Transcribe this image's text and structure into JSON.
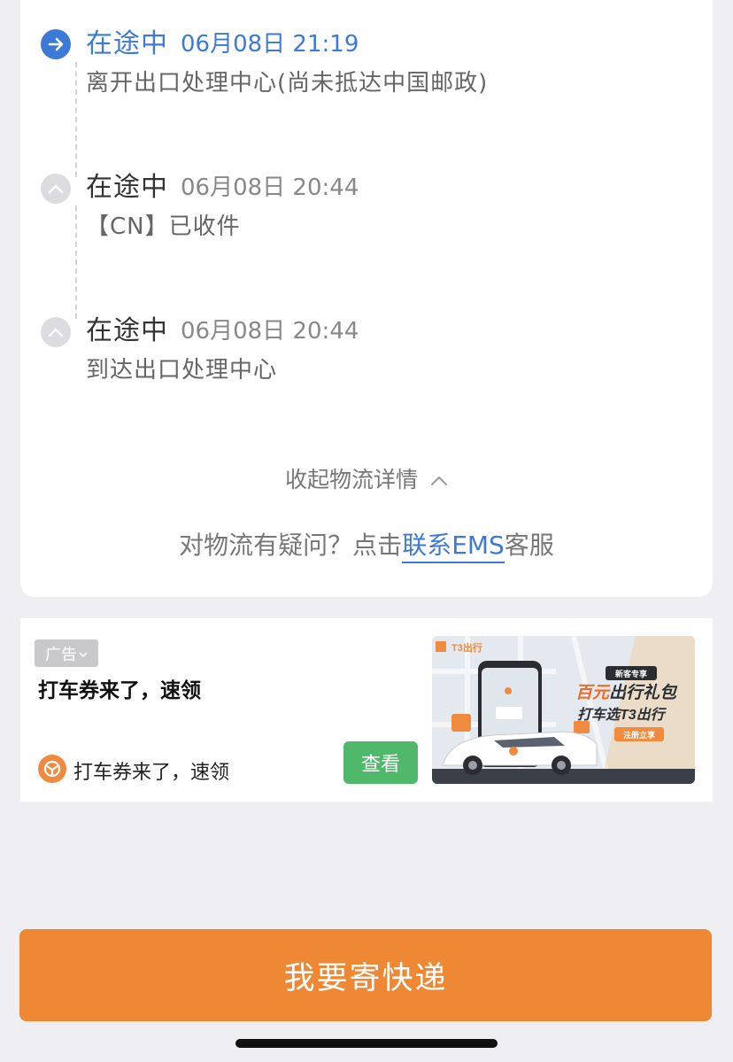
{
  "timeline": [
    {
      "status": "在途中",
      "time": "06月08日 21:19",
      "desc": "离开出口处理中心(尚未抵达中国邮政)",
      "active": true
    },
    {
      "status": "在途中",
      "time": "06月08日 20:44",
      "desc": "【CN】已收件",
      "active": false
    },
    {
      "status": "在途中",
      "time": "06月08日 20:44",
      "desc": "到达出口处理中心",
      "active": false
    }
  ],
  "collapse_label": "收起物流详情",
  "help": {
    "prefix": "对物流有疑问？点击",
    "link": "联系EMS",
    "suffix": "客服"
  },
  "ad": {
    "tag": "广告",
    "title": "打车券来了，速领",
    "brand_text": "打车券来了，速领",
    "button": "查看",
    "image": {
      "brand": "T3出行",
      "badge": "新客专享",
      "headline_1": "百元",
      "headline_2": "出行礼包",
      "subline": "打车选T3出行",
      "cta": "注册立享"
    }
  },
  "cta_label": "我要寄快递",
  "colors": {
    "accent": "#3d7ad8",
    "cta": "#ef8834",
    "ad_button": "#4fb86a"
  }
}
